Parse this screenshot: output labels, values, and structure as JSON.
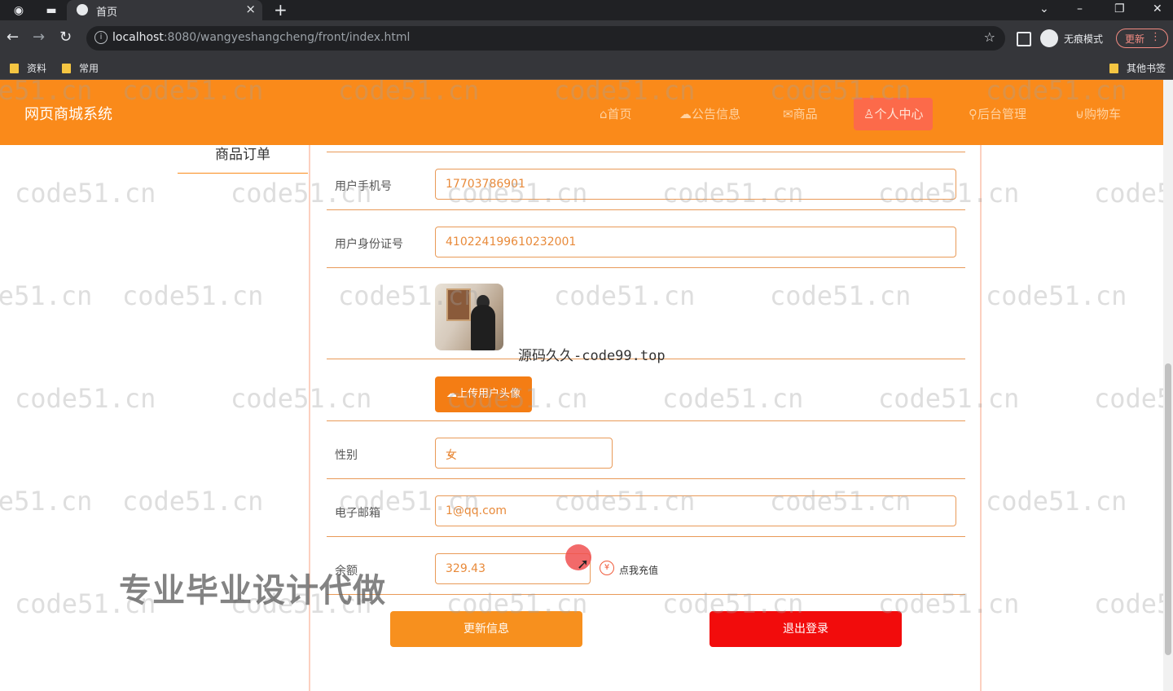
{
  "browser": {
    "tab_title": "首页",
    "url_host": "localhost",
    "url_path": ":8080/wangyeshangcheng/front/index.html",
    "profile_label": "无痕模式",
    "update_label": "更新",
    "bookmarks": [
      "资料",
      "常用"
    ],
    "other_bookmarks": "其他书签"
  },
  "header": {
    "site_title": "网页商城系统",
    "nav": [
      {
        "icon": "home-icon",
        "label": "首页"
      },
      {
        "icon": "announcement-icon",
        "label": "公告信息"
      },
      {
        "icon": "goods-icon",
        "label": "商品"
      },
      {
        "icon": "user-icon",
        "label": "个人中心",
        "active": true
      },
      {
        "icon": "link-icon",
        "label": "后台管理"
      },
      {
        "icon": "cart-icon",
        "label": "购物车"
      }
    ]
  },
  "sidebar": {
    "items": [
      {
        "label": "商品订单"
      }
    ]
  },
  "form": {
    "phone_label": "用户手机号",
    "phone_value": "17703786901",
    "idcard_label": "用户身份证号",
    "idcard_value": "410224199610232001",
    "upload_label": "上传用户头像",
    "gender_label": "性别",
    "gender_value": "女",
    "email_label": "电子邮箱",
    "email_value": "1@qq.com",
    "balance_label": "余额",
    "balance_value": "329.43",
    "recharge_icon": "¥",
    "recharge_label": "点我充值",
    "update_button": "更新信息",
    "logout_button": "退出登录"
  },
  "overlays": {
    "watermark": "code51.cn",
    "promo": "专业毕业设计代做",
    "source_mark": "源码久久-code99.top"
  },
  "colors": {
    "header_bg": "#fa8a1a",
    "nav_active_bg": "#fc6a4a",
    "border_accent": "#e99a58",
    "logout_bg": "#f20c0c"
  }
}
